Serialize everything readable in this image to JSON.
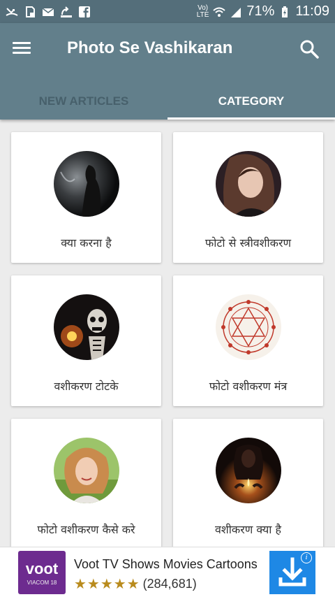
{
  "status_bar": {
    "network_label_top": "Vo)",
    "network_label_bottom": "LTE",
    "battery_percent": "71%",
    "time": "11:09",
    "left_icons": [
      "missed-call-icon",
      "sd-card-icon",
      "email-icon",
      "call-forward-icon",
      "facebook-icon"
    ],
    "right_icons": [
      "wifi-icon",
      "signal-icon",
      "battery-icon"
    ]
  },
  "app_bar": {
    "title": "Photo Se Vashikaran",
    "menu_icon": "hamburger-menu-icon",
    "search_icon": "search-icon",
    "background": "#627f8b"
  },
  "tabs": [
    {
      "label": "NEW ARTICLES",
      "active": false
    },
    {
      "label": "CATEGORY",
      "active": true
    }
  ],
  "categories": [
    {
      "label": "क्या करना है",
      "image": "dark-silhouette-photo"
    },
    {
      "label": "फोटो से स्त्रीवशीकरण",
      "image": "woman-portrait-photo"
    },
    {
      "label": "वशीकरण टोटके",
      "image": "skeleton-candle-photo"
    },
    {
      "label": "फोटो वशीकरण मंत्र",
      "image": "yantra-diagram-photo"
    },
    {
      "label": "फोटो वशीकरण कैसे करे",
      "image": "smiling-woman-photo"
    },
    {
      "label": "वशीकरण क्या है",
      "image": "candle-ritual-photo"
    }
  ],
  "ad": {
    "logo_text": "voot",
    "logo_subtext": "VIACOM 18",
    "title": "Voot TV Shows Movies Cartoons",
    "stars": "★★★★★",
    "rating": 4.5,
    "rating_count": "(284,681)",
    "download_icon": "download-icon",
    "info_icon": "info-icon",
    "star_color": "#b98b1d"
  }
}
